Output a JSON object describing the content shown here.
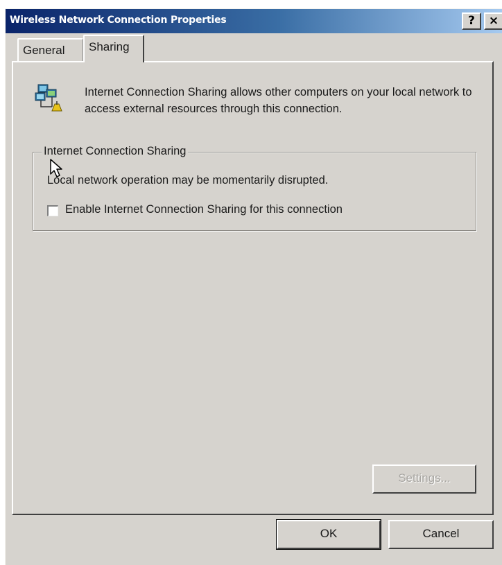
{
  "window": {
    "title": "Wireless Network Connection Properties",
    "help_button": "?",
    "close_button": "×"
  },
  "tabs": [
    {
      "label": "General",
      "selected": false
    },
    {
      "label": "Sharing",
      "selected": true
    }
  ],
  "sharing": {
    "intro_text": "Internet Connection Sharing allows other computers on your local network to access external resources through this connection.",
    "group_title": "Internet Connection Sharing",
    "note": "Local network operation may be momentarily disrupted.",
    "enable_checkbox": {
      "label": "Enable Internet Connection Sharing for this connection",
      "checked": false
    },
    "settings_button": {
      "label": "Settings...",
      "enabled": false
    }
  },
  "footer": {
    "ok_label": "OK",
    "cancel_label": "Cancel"
  },
  "icons": {
    "network": "network-connection-icon",
    "cursor": "mouse-pointer-icon"
  },
  "colors": {
    "titlebar_start": "#0a246a",
    "titlebar_end": "#a6caf0",
    "dialog_face": "#d6d3ce"
  }
}
